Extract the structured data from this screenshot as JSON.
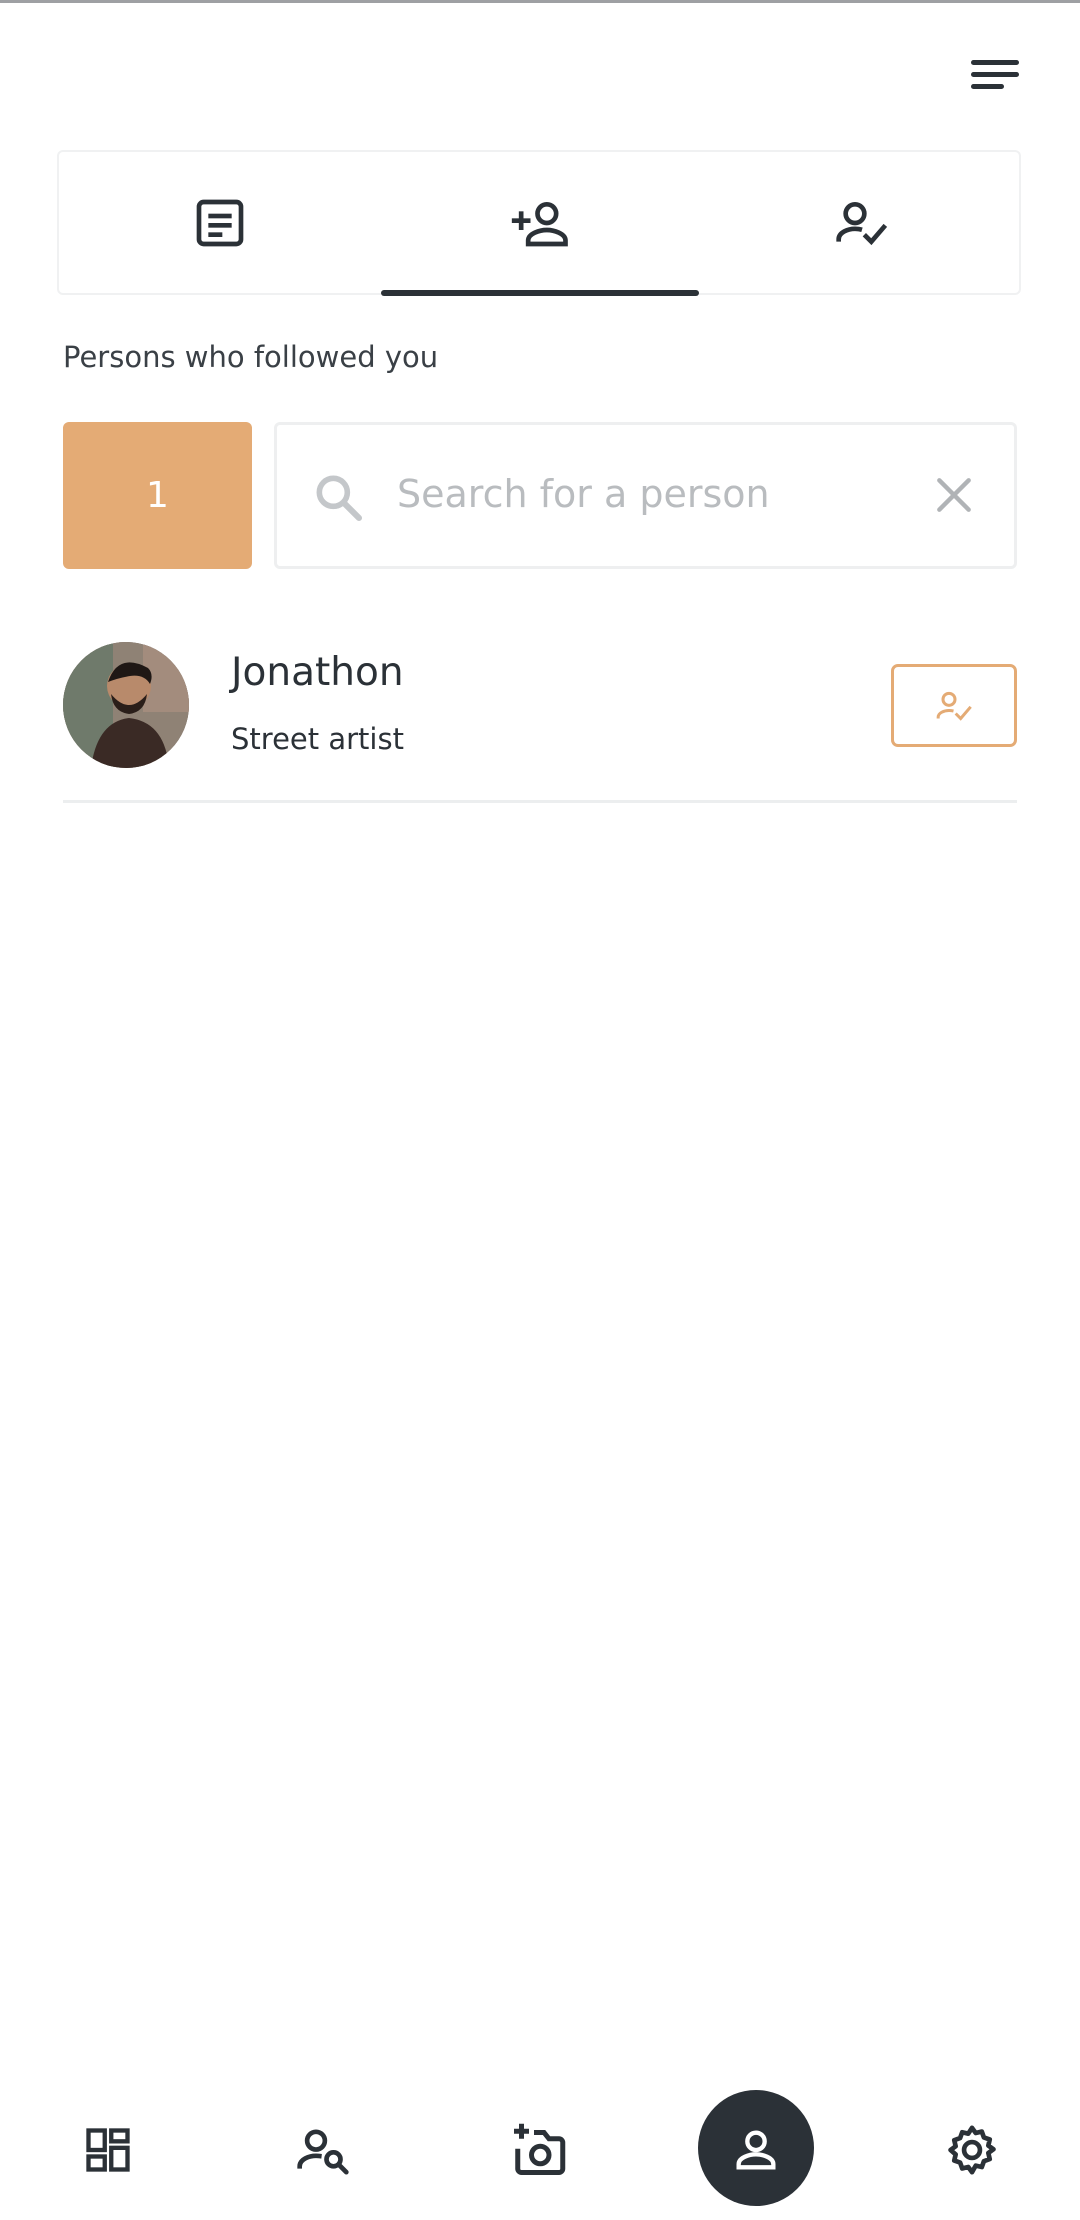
{
  "header": {
    "menu_icon": "hamburger-menu-icon"
  },
  "tabs": [
    {
      "icon": "posts-icon",
      "name": "posts",
      "active": false
    },
    {
      "icon": "person-add-icon",
      "name": "followers",
      "active": true
    },
    {
      "icon": "person-check-icon",
      "name": "following",
      "active": false
    }
  ],
  "section": {
    "label": "Persons who followed you"
  },
  "count_badge": "1",
  "search": {
    "placeholder": "Search for a person",
    "value": ""
  },
  "people": [
    {
      "name": "Jonathon",
      "role": "Street artist",
      "action_icon": "person-check-icon"
    }
  ],
  "bottom_nav": [
    {
      "icon": "dashboard-icon",
      "active": false
    },
    {
      "icon": "person-search-icon",
      "active": false
    },
    {
      "icon": "add-photo-icon",
      "active": false
    },
    {
      "icon": "profile-icon",
      "active": true
    },
    {
      "icon": "settings-icon",
      "active": false
    }
  ],
  "colors": {
    "accent": "#e4ab75",
    "dark": "#2b3137",
    "border": "#eeeff0"
  }
}
